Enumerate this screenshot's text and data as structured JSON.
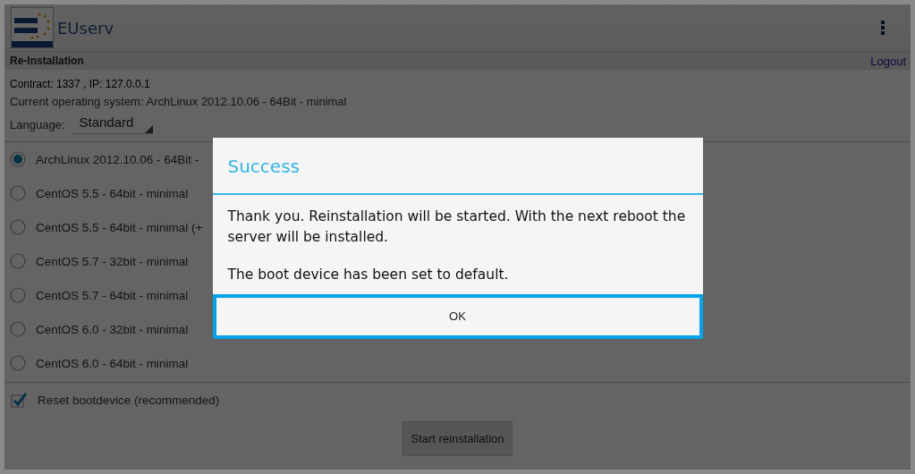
{
  "app_bar": {
    "title": "EUserv"
  },
  "section": {
    "title": "Re-Installation",
    "logout": "Logout"
  },
  "info": {
    "contract": "Contract: 1337 , IP: 127.0.0.1",
    "current_os": "Current operating system: ArchLinux 2012.10.06 - 64Bit - minimal",
    "language_label": "Language:",
    "language_value": "Standard"
  },
  "os_options": [
    {
      "label": "ArchLinux 2012.10.06 - 64Bit -",
      "selected": true
    },
    {
      "label": "CentOS 5.5 - 64bit - minimal",
      "selected": false
    },
    {
      "label": "CentOS 5.5 - 64bit - minimal (+",
      "selected": false
    },
    {
      "label": "CentOS 5.7 - 32bit - minimal",
      "selected": false
    },
    {
      "label": "CentOS 5.7 - 64bit - minimal",
      "selected": false
    },
    {
      "label": "CentOS 6.0 - 32bit - minimal",
      "selected": false
    },
    {
      "label": "CentOS 6.0 - 64bit - minimal",
      "selected": false
    }
  ],
  "reset_bootdevice": {
    "label": "Reset bootdevice (recommended)",
    "checked": true
  },
  "start_button": "Start reinstallation",
  "dialog": {
    "title": "Success",
    "messages": [
      "Thank you. Reinstallation will be started. With the next reboot the server will be installed.",
      "The boot device has been set to default."
    ],
    "button": "OK"
  }
}
